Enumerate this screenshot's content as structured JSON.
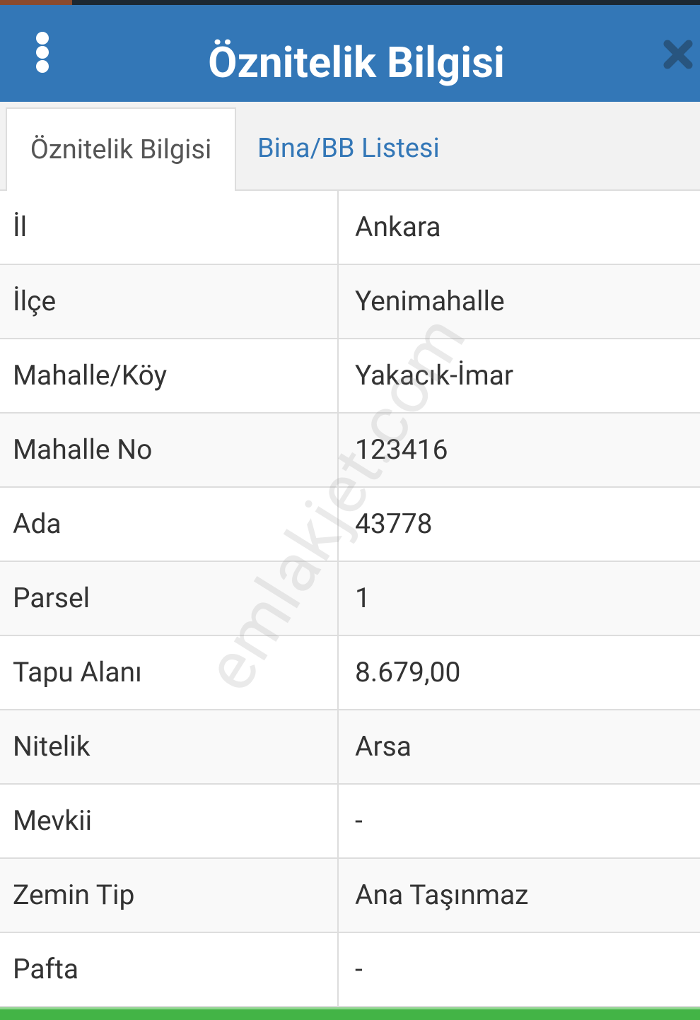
{
  "header": {
    "title": "Öznitelik Bilgisi",
    "menu_icon": "vertical-dots-icon",
    "close_icon": "close-icon",
    "background_color": "#3377b7"
  },
  "tabs": [
    {
      "label": "Öznitelik Bilgisi",
      "active": true
    },
    {
      "label": "Bina/BB Listesi",
      "active": false
    }
  ],
  "attributes": [
    {
      "label": "İl",
      "value": "Ankara"
    },
    {
      "label": "İlçe",
      "value": "Yenimahalle"
    },
    {
      "label": "Mahalle/Köy",
      "value": "Yakacık-İmar"
    },
    {
      "label": "Mahalle No",
      "value": "123416"
    },
    {
      "label": "Ada",
      "value": "43778"
    },
    {
      "label": "Parsel",
      "value": "1"
    },
    {
      "label": "Tapu Alanı",
      "value": "8.679,00"
    },
    {
      "label": "Nitelik",
      "value": "Arsa"
    },
    {
      "label": "Mevkii",
      "value": "-"
    },
    {
      "label": "Zemin Tip",
      "value": "Ana Taşınmaz"
    },
    {
      "label": "Pafta",
      "value": "-"
    }
  ],
  "watermark": "emlakjet.com",
  "colors": {
    "accent": "#3377b7",
    "footer": "#43b446"
  }
}
